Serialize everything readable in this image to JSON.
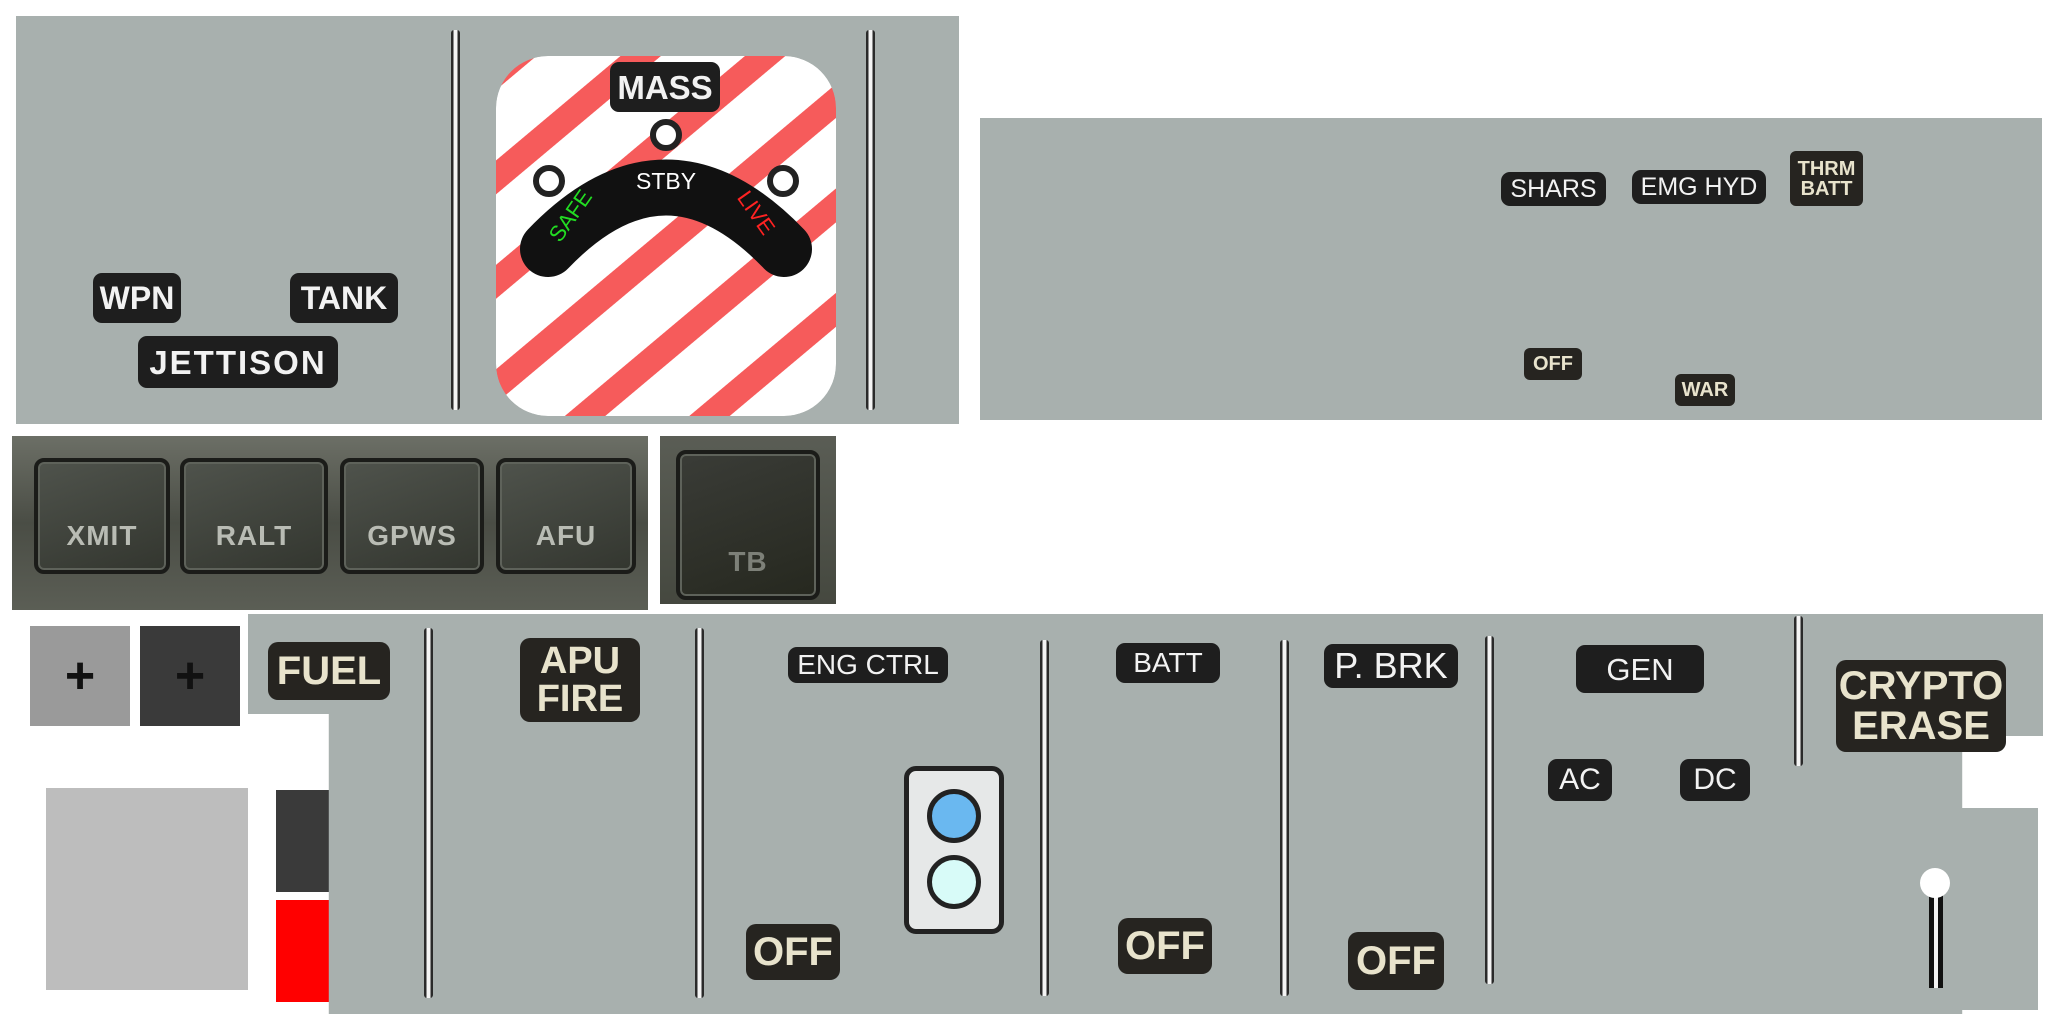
{
  "colors": {
    "panel": "#a8b0ae",
    "label_bg": "#1e1e1e",
    "label_text": "#f2f2f2",
    "hazard_red": "#f65b5b",
    "safe_green": "#22dd22",
    "live_red": "#ff2222",
    "lamp_blue": "#6ab8f0",
    "lamp_cyan": "#d8fbf8",
    "swatch_light": "#9a9a9a",
    "swatch_dark": "#3a3a3a",
    "swatch_grey": "#bdbdbd",
    "swatch_red": "#ff0000"
  },
  "jettison_panel": {
    "wpn": "WPN",
    "tank": "TANK",
    "jettison": "JETTISON"
  },
  "master_arm": {
    "mass": "MASS",
    "stby": "STBY",
    "safe": "SAFE",
    "live": "LIVE"
  },
  "emergency_panel": {
    "shars": "SHARS",
    "emg_hyd": "EMG HYD",
    "thrm_line1": "THRM",
    "thrm_line2": "BATT",
    "off": "OFF",
    "war": "WAR"
  },
  "push_buttons": [
    {
      "label": "XMIT",
      "icon": "square-pushbutton"
    },
    {
      "label": "RALT",
      "icon": "square-pushbutton"
    },
    {
      "label": "GPWS",
      "icon": "square-pushbutton"
    },
    {
      "label": "AFU",
      "icon": "square-pushbutton"
    }
  ],
  "tb_button": {
    "label": "TB"
  },
  "swatches": {
    "plus_light": "+",
    "plus_dark": "+"
  },
  "lower_panel": {
    "fuel": "FUEL",
    "apu_line1": "APU",
    "apu_line2": "FIRE",
    "eng_ctrl": "ENG CTRL",
    "batt": "BATT",
    "p_brk": "P. BRK",
    "gen": "GEN",
    "ac": "AC",
    "dc": "DC",
    "off_eng": "OFF",
    "off_batt": "OFF",
    "off_brk": "OFF",
    "crypto_line1": "CRYPTO",
    "crypto_line2": "ERASE"
  }
}
